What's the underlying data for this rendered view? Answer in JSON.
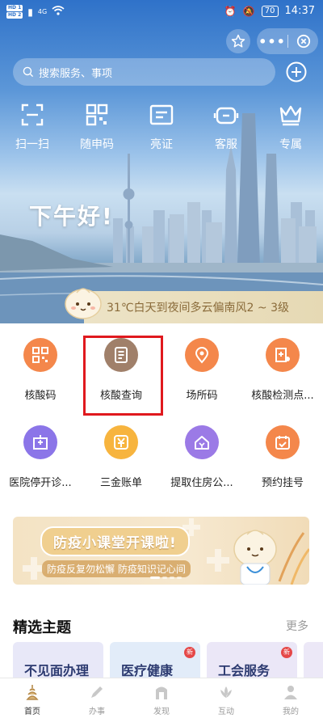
{
  "statusbar": {
    "sim1": "HD 1",
    "sim2": "HD 2",
    "network": "4G",
    "battery": "70",
    "time": "14:37"
  },
  "search": {
    "placeholder": "搜索服务、事项"
  },
  "quick_actions": [
    {
      "label": "扫一扫",
      "icon": "scan-icon"
    },
    {
      "label": "随申码",
      "icon": "qr-code-icon"
    },
    {
      "label": "亮证",
      "icon": "id-card-icon"
    },
    {
      "label": "客服",
      "icon": "headset-icon"
    },
    {
      "label": "专属",
      "icon": "crown-icon"
    }
  ],
  "greeting": "下午好!",
  "weather": "31℃白天到夜间多云偏南风2 ~ 3级",
  "services": [
    {
      "label": "核酸码",
      "icon": "qr-grid-icon",
      "color": "#f4874b"
    },
    {
      "label": "核酸查询",
      "icon": "document-list-icon",
      "color": "#a0806a"
    },
    {
      "label": "场所码",
      "icon": "location-pin-icon",
      "color": "#f4874b"
    },
    {
      "label": "核酸检测点...",
      "icon": "hospital-pin-icon",
      "color": "#f4874b"
    },
    {
      "label": "医院停开诊...",
      "icon": "hospital-building-icon",
      "color": "#8b75e8"
    },
    {
      "label": "三金账单",
      "icon": "yuan-bill-icon",
      "color": "#f7b43e"
    },
    {
      "label": "提取住房公...",
      "icon": "housing-fund-icon",
      "color": "#9b7ae6"
    },
    {
      "label": "预约挂号",
      "icon": "calendar-check-icon",
      "color": "#f4874b"
    }
  ],
  "banner": {
    "title": "防疫小课堂开课啦!",
    "subtitle": "防疫反复勿松懈 防疫知识记心间"
  },
  "featured": {
    "title": "精选主题",
    "more": "更多",
    "topics": [
      {
        "label": "不见面办理",
        "new": false,
        "bg": "#e8e8f8"
      },
      {
        "label": "医疗健康",
        "new": true,
        "bg": "#e2ecf9"
      },
      {
        "label": "工会服务",
        "new": true,
        "bg": "#ebe7f7"
      }
    ],
    "new_badge": "新"
  },
  "tabbar": [
    {
      "label": "首页",
      "active": true
    },
    {
      "label": "办事",
      "active": false
    },
    {
      "label": "发现",
      "active": false
    },
    {
      "label": "互动",
      "active": false
    },
    {
      "label": "我的",
      "active": false
    }
  ],
  "colors": {
    "highlight": "#e0191e",
    "accent": "#f4874b"
  }
}
